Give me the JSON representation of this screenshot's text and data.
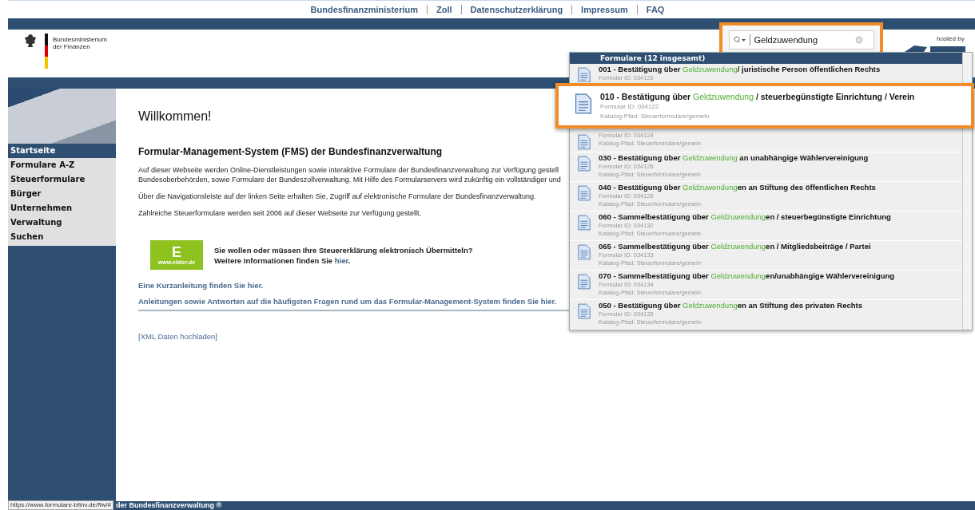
{
  "top_links": [
    "Bundesfinanzministerium",
    "Zoll",
    "Datenschutzerklärung",
    "Impressum",
    "FAQ"
  ],
  "logo": {
    "line1": "Bundesministerium",
    "line2": "der Finanzen"
  },
  "search": {
    "value": "Geldzuwendung"
  },
  "hosted_by": "hosted by",
  "suggestions": {
    "header": "Formulare (12 insgesamt)",
    "items": [
      {
        "before": "001 - Bestätigung über ",
        "match": "Geldzuwendung",
        "after": "/ juristische Person öffentlichen Rechts",
        "id": "Formular ID: 034120",
        "highlighted": false
      },
      {
        "before": "010 - Bestätigung über ",
        "match": "Geldzuwendung",
        "after": " / steuerbegünstigte Einrichtung / Verein",
        "id": "Formular ID: 034122",
        "path": "Katalog-Pfad: Steuerformulare/gemein",
        "highlighted": true
      },
      {
        "id": "Formular ID: 034124",
        "path": "Katalog-Pfad: Steuerformulare/gemein",
        "highlighted": false
      },
      {
        "before": "030 - Bestätigung über ",
        "match": "Geldzuwendung",
        "after": " an unabhängige Wählervereinigung",
        "id": "Formular ID: 034126",
        "path": "Katalog-Pfad: Steuerformulare/gemein",
        "highlighted": false
      },
      {
        "before": "040 - Bestätigung über ",
        "match": "Geldzuwendung",
        "after": "en an Stiftung des öffentlichen Rechts",
        "id": "Formular ID: 034128",
        "path": "Katalog-Pfad: Steuerformulare/gemein",
        "highlighted": false
      },
      {
        "before": "060 - Sammelbestätigung über ",
        "match": "Geldzuwendung",
        "after": "en / steuerbegünstigte Einrichtung",
        "id": "Formular ID: 034132",
        "path": "Katalog-Pfad: Steuerformulare/gemein",
        "highlighted": false
      },
      {
        "before": "065 - Sammelbestätigung über ",
        "match": "Geldzuwendung",
        "after": "en / Mitgliedsbeiträge / Partei",
        "id": "Formular ID: 034133",
        "path": "Katalog-Pfad: Steuerformulare/gemein",
        "highlighted": false
      },
      {
        "before": "070 - Sammelbestätigung über ",
        "match": "Geldzuwendung",
        "after": "en/unabhängige Wählervereinigung",
        "id": "Formular ID: 034134",
        "path": "Katalog-Pfad: Steuerformulare/gemein",
        "highlighted": false
      },
      {
        "before": "050 - Bestätigung über ",
        "match": "Geldzuwendung",
        "after": "en an Stiftung des privaten Rechts",
        "id": "Formular ID: 034135",
        "path": "Katalog-Pfad: Steuerformulare/gemein",
        "highlighted": false
      }
    ]
  },
  "sidebar": {
    "items": [
      {
        "label": "Startseite",
        "selected": true
      },
      {
        "label": "Formulare A-Z",
        "selected": false
      },
      {
        "label": "Steuerformulare",
        "selected": false
      },
      {
        "label": "Bürger",
        "selected": false
      },
      {
        "label": "Unternehmen",
        "selected": false
      },
      {
        "label": "Verwaltung",
        "selected": false
      },
      {
        "label": "Suchen",
        "selected": false
      }
    ]
  },
  "content": {
    "title": "Willkommen!",
    "heading": "Formular-Management-System (FMS) der Bundesfinanzverwaltung",
    "intro_lines": [
      "Auf dieser Webseite werden Online-Dienstleistungen sowie interaktive Formulare der Bundesfinanzverwaltung zur Verfügung gestell",
      "Bundesoberbehörden, sowie Formulare der Bundeszollverwaltung. Mit Hilfe des Formularservers wird zukünftig ein vollständiger und"
    ],
    "paragraphs": [
      "Über die Navigationsleiste auf der linken Seite erhalten Sie, Zugriff auf elektronische Formulare der Bundesfinanzverwaltung.",
      "Zahlreiche Steuerformulare werden seit 2006 auf dieser Webseite zur Verfügung gestellt."
    ],
    "elster": {
      "letter": "E",
      "url": "www.elster.de",
      "line1": "Sie wollen oder müssen Ihre Steuererklärung elektronisch Übermitteln?",
      "line2": "Weitere Informationen finden Sie ",
      "link": "hier",
      "end": "."
    },
    "links": [
      "Eine Kurzanleitung finden Sie hier.",
      "Anleitungen sowie Antworten auf die häufigsten Fragen rund um das Formular-Management-System finden Sie hier."
    ],
    "xml_link": "[XML Daten hochladen]"
  },
  "status_url": "https://www.formulare-bfinv.de/ffw/#",
  "footer": "der Bundesfinanzverwaltung ®"
}
